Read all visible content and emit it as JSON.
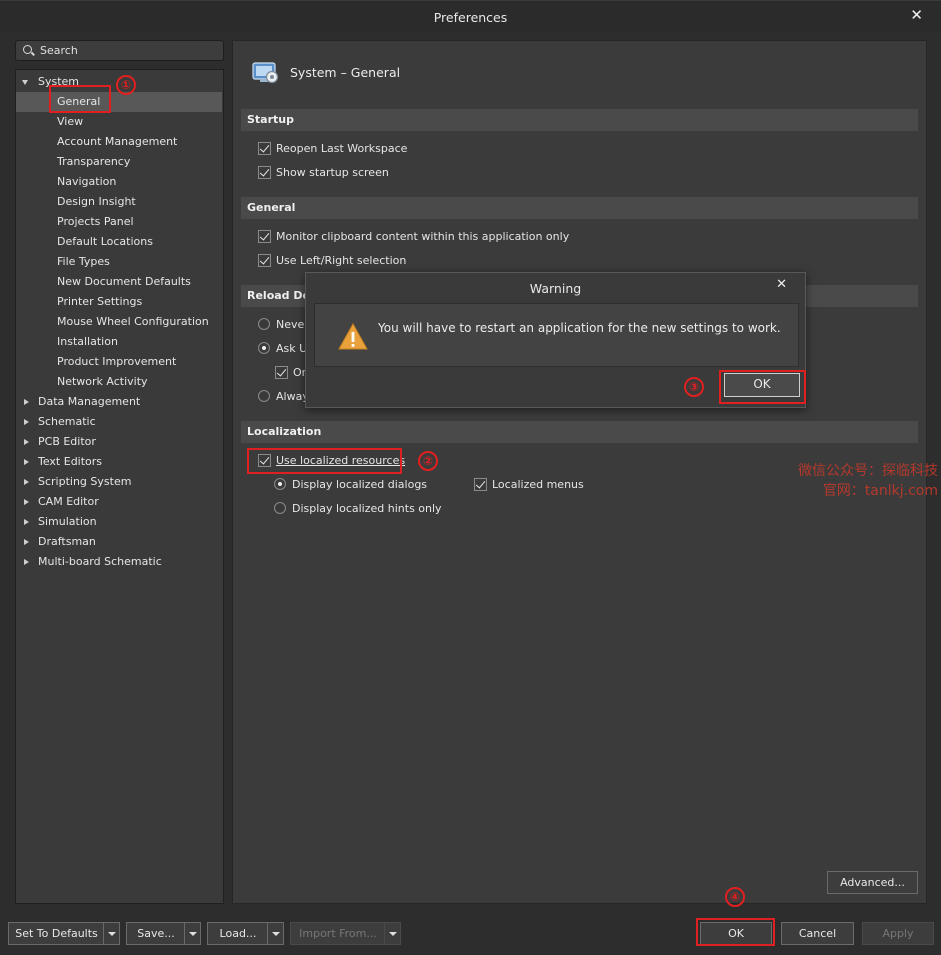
{
  "window": {
    "title": "Preferences"
  },
  "search": {
    "placeholder": "Search"
  },
  "tree": {
    "system": "System",
    "system_children": [
      "General",
      "View",
      "Account Management",
      "Transparency",
      "Navigation",
      "Design Insight",
      "Projects Panel",
      "Default Locations",
      "File Types",
      "New Document Defaults",
      "Printer Settings",
      "Mouse Wheel Configuration",
      "Installation",
      "Product Improvement",
      "Network Activity"
    ],
    "top_items": [
      "Data Management",
      "Schematic",
      "PCB Editor",
      "Text Editors",
      "Scripting System",
      "CAM Editor",
      "Simulation",
      "Draftsman",
      "Multi-board Schematic"
    ],
    "selected": "General"
  },
  "page": {
    "title": "System – General",
    "sections": {
      "startup": "Startup",
      "general": "General",
      "reload": "Reload Doc",
      "localization": "Localization"
    },
    "startup": {
      "reopen_last_workspace": "Reopen Last Workspace",
      "show_startup_screen": "Show startup screen"
    },
    "general": {
      "monitor_clipboard": "Monitor clipboard content within this application only",
      "left_right_selection": "Use Left/Right selection"
    },
    "reload": {
      "never": "Never",
      "ask_user": "Ask Us",
      "only": "Or",
      "always": "Alway"
    },
    "localization": {
      "use_localized_resources": "Use localized resources",
      "display_localized_dialogs": "Display localized dialogs",
      "display_localized_hints_only": "Display localized hints only",
      "localized_menus": "Localized menus"
    },
    "advanced_button": "Advanced..."
  },
  "dialog": {
    "title": "Warning",
    "message": "You will have to restart an application for the new settings to work.",
    "ok": "OK"
  },
  "footer": {
    "set_to_defaults": "Set To Defaults",
    "save": "Save...",
    "load": "Load...",
    "import_from": "Import From...",
    "ok": "OK",
    "cancel": "Cancel",
    "apply": "Apply"
  },
  "annotations": {
    "m1": "①",
    "m2": "②",
    "m3": "③",
    "m4": "④"
  },
  "watermark": {
    "line1": "微信公众号：探临科技",
    "line2": "官网：tanlkj.com"
  },
  "colors": {
    "annotation_red": "#e02020",
    "background": "#2d2d2d",
    "panel": "#3b3b3b",
    "selected": "#585858"
  }
}
